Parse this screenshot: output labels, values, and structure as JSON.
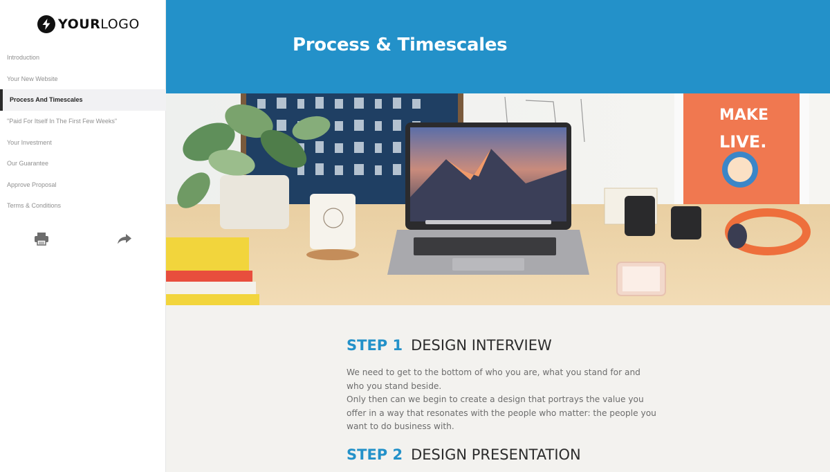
{
  "logo": {
    "bold": "YOUR",
    "light": "LOGO"
  },
  "sidebar": {
    "items": [
      {
        "label": "Introduction"
      },
      {
        "label": "Your New Website"
      },
      {
        "label": "Process And Timescales"
      },
      {
        "label": "\"Paid For Itself In The First Few Weeks\""
      },
      {
        "label": "Your Investment"
      },
      {
        "label": "Our Guarantee"
      },
      {
        "label": "Approve Proposal"
      },
      {
        "label": "Terms & Conditions"
      }
    ],
    "active_index": 2,
    "tools": {
      "print_icon": "printer-icon",
      "share_icon": "share-arrow-icon"
    }
  },
  "header": {
    "title": "Process & Timescales"
  },
  "colors": {
    "accent": "#2391c9",
    "text_dark": "#2c2c2c",
    "text_body": "#6c6c6c",
    "background": "#f3f2ef"
  },
  "steps": [
    {
      "number": "STEP 1",
      "title": "DESIGN INTERVIEW",
      "paragraphs": [
        "We need to get to the bottom of who you are, what you stand for and who you stand beside.",
        "Only then can we begin to create a design that portrays the value you offer in a way that resonates with the people who matter: the people you want to do business with."
      ]
    },
    {
      "number": "STEP 2",
      "title": "DESIGN PRESENTATION"
    }
  ]
}
